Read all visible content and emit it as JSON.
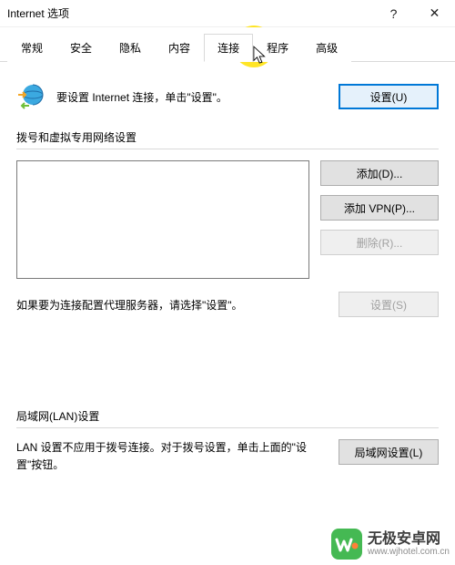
{
  "window": {
    "title": "Internet 选项",
    "help": "?",
    "close": "✕"
  },
  "tabs": {
    "general": "常规",
    "security": "安全",
    "privacy": "隐私",
    "content": "内容",
    "connections": "连接",
    "programs": "程序",
    "advanced": "高级"
  },
  "conn": {
    "setup_text": "要设置 Internet 连接，单击\"设置\"。",
    "setup_btn": "设置(U)"
  },
  "dial": {
    "title": "拨号和虚拟专用网络设置",
    "add": "添加(D)...",
    "add_vpn": "添加 VPN(P)...",
    "remove": "删除(R)...",
    "proxy_text": "如果要为连接配置代理服务器，请选择\"设置\"。",
    "settings": "设置(S)"
  },
  "lan": {
    "title": "局域网(LAN)设置",
    "desc": "LAN 设置不应用于拨号连接。对于拨号设置，单击上面的\"设置\"按钮。",
    "btn": "局域网设置(L)"
  },
  "watermark": {
    "main": "无极安卓网",
    "sub": "www.wjhotel.com.cn"
  }
}
